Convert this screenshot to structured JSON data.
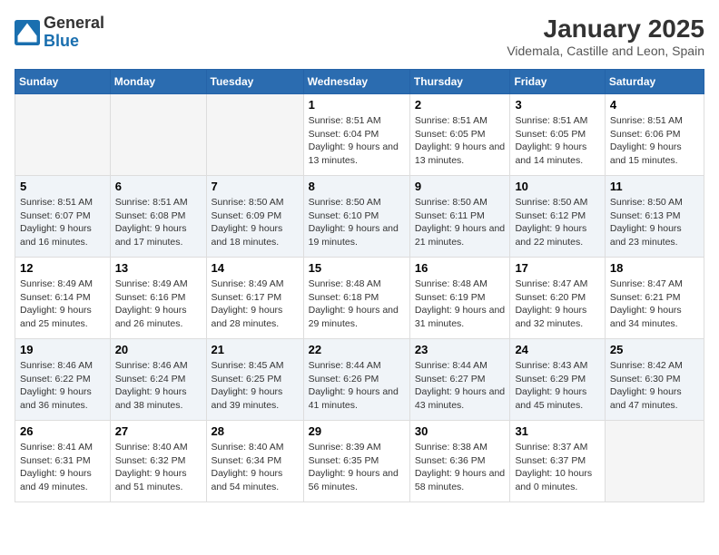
{
  "logo": {
    "general": "General",
    "blue": "Blue"
  },
  "title": "January 2025",
  "subtitle": "Videmala, Castille and Leon, Spain",
  "weekdays": [
    "Sunday",
    "Monday",
    "Tuesday",
    "Wednesday",
    "Thursday",
    "Friday",
    "Saturday"
  ],
  "weeks": [
    [
      {
        "day": "",
        "info": ""
      },
      {
        "day": "",
        "info": ""
      },
      {
        "day": "",
        "info": ""
      },
      {
        "day": "1",
        "info": "Sunrise: 8:51 AM\nSunset: 6:04 PM\nDaylight: 9 hours and 13 minutes."
      },
      {
        "day": "2",
        "info": "Sunrise: 8:51 AM\nSunset: 6:05 PM\nDaylight: 9 hours and 13 minutes."
      },
      {
        "day": "3",
        "info": "Sunrise: 8:51 AM\nSunset: 6:05 PM\nDaylight: 9 hours and 14 minutes."
      },
      {
        "day": "4",
        "info": "Sunrise: 8:51 AM\nSunset: 6:06 PM\nDaylight: 9 hours and 15 minutes."
      }
    ],
    [
      {
        "day": "5",
        "info": "Sunrise: 8:51 AM\nSunset: 6:07 PM\nDaylight: 9 hours and 16 minutes."
      },
      {
        "day": "6",
        "info": "Sunrise: 8:51 AM\nSunset: 6:08 PM\nDaylight: 9 hours and 17 minutes."
      },
      {
        "day": "7",
        "info": "Sunrise: 8:50 AM\nSunset: 6:09 PM\nDaylight: 9 hours and 18 minutes."
      },
      {
        "day": "8",
        "info": "Sunrise: 8:50 AM\nSunset: 6:10 PM\nDaylight: 9 hours and 19 minutes."
      },
      {
        "day": "9",
        "info": "Sunrise: 8:50 AM\nSunset: 6:11 PM\nDaylight: 9 hours and 21 minutes."
      },
      {
        "day": "10",
        "info": "Sunrise: 8:50 AM\nSunset: 6:12 PM\nDaylight: 9 hours and 22 minutes."
      },
      {
        "day": "11",
        "info": "Sunrise: 8:50 AM\nSunset: 6:13 PM\nDaylight: 9 hours and 23 minutes."
      }
    ],
    [
      {
        "day": "12",
        "info": "Sunrise: 8:49 AM\nSunset: 6:14 PM\nDaylight: 9 hours and 25 minutes."
      },
      {
        "day": "13",
        "info": "Sunrise: 8:49 AM\nSunset: 6:16 PM\nDaylight: 9 hours and 26 minutes."
      },
      {
        "day": "14",
        "info": "Sunrise: 8:49 AM\nSunset: 6:17 PM\nDaylight: 9 hours and 28 minutes."
      },
      {
        "day": "15",
        "info": "Sunrise: 8:48 AM\nSunset: 6:18 PM\nDaylight: 9 hours and 29 minutes."
      },
      {
        "day": "16",
        "info": "Sunrise: 8:48 AM\nSunset: 6:19 PM\nDaylight: 9 hours and 31 minutes."
      },
      {
        "day": "17",
        "info": "Sunrise: 8:47 AM\nSunset: 6:20 PM\nDaylight: 9 hours and 32 minutes."
      },
      {
        "day": "18",
        "info": "Sunrise: 8:47 AM\nSunset: 6:21 PM\nDaylight: 9 hours and 34 minutes."
      }
    ],
    [
      {
        "day": "19",
        "info": "Sunrise: 8:46 AM\nSunset: 6:22 PM\nDaylight: 9 hours and 36 minutes."
      },
      {
        "day": "20",
        "info": "Sunrise: 8:46 AM\nSunset: 6:24 PM\nDaylight: 9 hours and 38 minutes."
      },
      {
        "day": "21",
        "info": "Sunrise: 8:45 AM\nSunset: 6:25 PM\nDaylight: 9 hours and 39 minutes."
      },
      {
        "day": "22",
        "info": "Sunrise: 8:44 AM\nSunset: 6:26 PM\nDaylight: 9 hours and 41 minutes."
      },
      {
        "day": "23",
        "info": "Sunrise: 8:44 AM\nSunset: 6:27 PM\nDaylight: 9 hours and 43 minutes."
      },
      {
        "day": "24",
        "info": "Sunrise: 8:43 AM\nSunset: 6:29 PM\nDaylight: 9 hours and 45 minutes."
      },
      {
        "day": "25",
        "info": "Sunrise: 8:42 AM\nSunset: 6:30 PM\nDaylight: 9 hours and 47 minutes."
      }
    ],
    [
      {
        "day": "26",
        "info": "Sunrise: 8:41 AM\nSunset: 6:31 PM\nDaylight: 9 hours and 49 minutes."
      },
      {
        "day": "27",
        "info": "Sunrise: 8:40 AM\nSunset: 6:32 PM\nDaylight: 9 hours and 51 minutes."
      },
      {
        "day": "28",
        "info": "Sunrise: 8:40 AM\nSunset: 6:34 PM\nDaylight: 9 hours and 54 minutes."
      },
      {
        "day": "29",
        "info": "Sunrise: 8:39 AM\nSunset: 6:35 PM\nDaylight: 9 hours and 56 minutes."
      },
      {
        "day": "30",
        "info": "Sunrise: 8:38 AM\nSunset: 6:36 PM\nDaylight: 9 hours and 58 minutes."
      },
      {
        "day": "31",
        "info": "Sunrise: 8:37 AM\nSunset: 6:37 PM\nDaylight: 10 hours and 0 minutes."
      },
      {
        "day": "",
        "info": ""
      }
    ]
  ]
}
